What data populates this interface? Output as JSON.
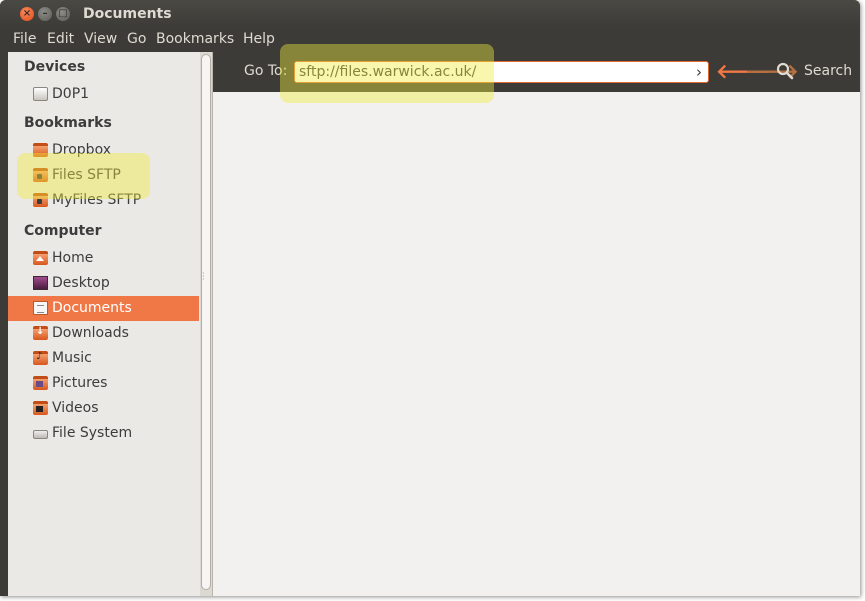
{
  "window": {
    "title": "Documents"
  },
  "menubar": [
    "File",
    "Edit",
    "View",
    "Go",
    "Bookmarks",
    "Help"
  ],
  "sidebar": {
    "sections": [
      {
        "header": "Devices",
        "items": [
          {
            "label": "D0P1",
            "icon": "drive-icon"
          }
        ]
      },
      {
        "header": "Bookmarks",
        "items": [
          {
            "label": "Dropbox",
            "icon": "folder-icon"
          },
          {
            "label": "Files SFTP",
            "icon": "network-bookmark-icon"
          },
          {
            "label": "MyFiles SFTP",
            "icon": "network-bookmark-icon"
          }
        ]
      },
      {
        "header": "Computer",
        "items": [
          {
            "label": "Home",
            "icon": "home-folder-icon"
          },
          {
            "label": "Desktop",
            "icon": "desktop-icon"
          },
          {
            "label": "Documents",
            "icon": "documents-folder-icon",
            "selected": true
          },
          {
            "label": "Downloads",
            "icon": "downloads-folder-icon"
          },
          {
            "label": "Music",
            "icon": "music-folder-icon"
          },
          {
            "label": "Pictures",
            "icon": "pictures-folder-icon"
          },
          {
            "label": "Videos",
            "icon": "videos-folder-icon"
          },
          {
            "label": "File System",
            "icon": "filesystem-icon"
          }
        ]
      }
    ]
  },
  "toolbar": {
    "goto_label": "Go To:",
    "location_value": "sftp://files.warwick.ac.uk/",
    "go_icon": "go-arrow-icon",
    "back_icon": "back-arrow-icon",
    "forward_icon": "forward-arrow-icon",
    "search_label": "Search"
  },
  "colors": {
    "accent": "#f07746",
    "titlebar": "#3c3b37",
    "sidebar_bg": "#ebe9e5",
    "content_bg": "#f2f1f0",
    "highlight": "#f0ec3c"
  }
}
